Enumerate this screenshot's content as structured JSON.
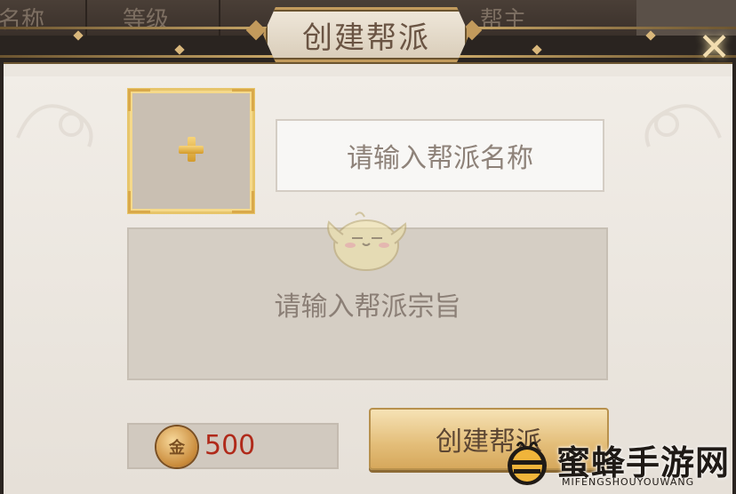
{
  "header": {
    "columns": [
      "名称",
      "等级",
      "",
      "帮主"
    ],
    "title": "创建帮派"
  },
  "form": {
    "avatar_icon": "plus-icon",
    "name_placeholder": "请输入帮派名称",
    "purpose_placeholder": "请输入帮派宗旨"
  },
  "cost": {
    "currency_icon": "gold-coin-icon",
    "coin_glyph": "金",
    "amount": "500"
  },
  "actions": {
    "create_label": "创建帮派"
  },
  "watermark": {
    "brand": "蜜蜂手游网",
    "subtitle": "MIFENGSHOUYOUWANG"
  },
  "colors": {
    "accent_gold": "#e3bd78",
    "cost_red": "#b02a1a",
    "panel_bg": "#ebe6df"
  }
}
